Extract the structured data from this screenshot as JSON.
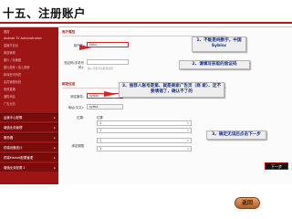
{
  "slide": {
    "title": "十五、注册账户",
    "return_label": "返回"
  },
  "sidebar": {
    "items": [
      {
        "label": "首页",
        "type": "item"
      },
      {
        "label": "Android TV Administration",
        "type": "item"
      },
      {
        "label": "直播节目目",
        "type": "sub"
      },
      {
        "label": "频道管理",
        "type": "sub"
      },
      {
        "label": "图片 / 轮播图",
        "type": "sub"
      },
      {
        "label": "图片推荐 / 篇上推荐",
        "type": "sub"
      },
      {
        "label": "新闻资讯列表",
        "type": "sub"
      },
      {
        "label": "会员管理系统",
        "type": "sub"
      },
      {
        "label": "电视直播",
        "type": "sub"
      },
      {
        "label": "通知消息",
        "type": "sub"
      },
      {
        "label": "广告业务",
        "type": "sub"
      },
      {
        "label": "运营中心配置",
        "type": "group"
      },
      {
        "label": "增值业务管理",
        "type": "group"
      },
      {
        "label": "服务器",
        "type": "group"
      },
      {
        "label": "终端设备统计",
        "type": "group"
      },
      {
        "label": "终端Market配置管理",
        "type": "group"
      },
      {
        "label": "增值业务配置 2",
        "type": "group"
      }
    ]
  },
  "form": {
    "section1_label": "用户属性",
    "fields": [
      {
        "label": "用户名:",
        "value": "Diou"
      },
      {
        "label": "验证码(手机号码):",
        "value": ""
      }
    ],
    "hint": "输入手机号获取验证码",
    "section2_label": "绑定信息",
    "bind_label": "绑定服务:",
    "bind_value": "sybisc",
    "addr_label": "地址(中文):",
    "addr_value": "sybsc",
    "region_label": "位置:",
    "region_rows": [
      {
        "label": "位置",
        "value": "1"
      },
      {
        "label": "",
        "value": "1"
      }
    ],
    "period_label": "绑定期限",
    "period_values": [
      "1",
      "1"
    ],
    "next_label": "下一步"
  },
  "callouts": {
    "c1": "1、不能是纯数字，中国 Sybisc",
    "c2": "2、请填写获取的验证码",
    "c3": "3、推荐人账号是第、就是商家广告页（商 家）、定不要填错了，确认不了的",
    "c4": "3、确定无误后点击下一步"
  }
}
